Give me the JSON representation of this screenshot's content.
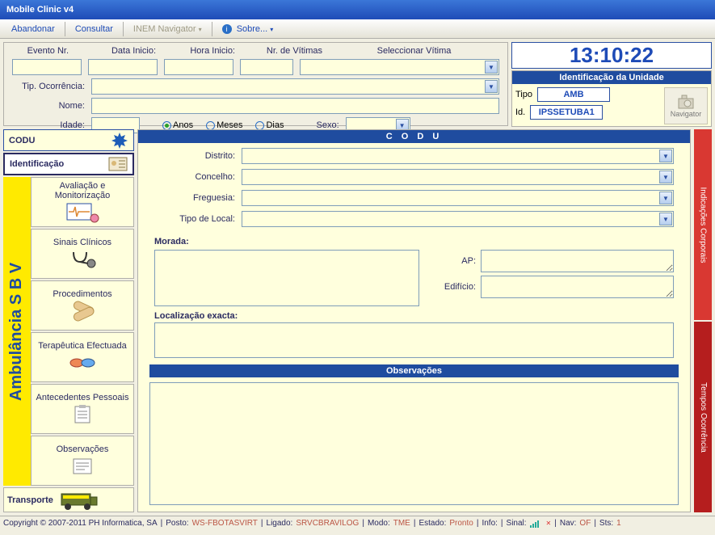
{
  "window_title": "Mobile Clinic v4",
  "menu": {
    "abandonar": "Abandonar",
    "consultar": "Consultar",
    "inem": "INEM Navigator",
    "sobre": "Sobre..."
  },
  "header": {
    "evento_nr": "Evento Nr.",
    "data_inicio": "Data Inicio:",
    "hora_inicio": "Hora Inicio:",
    "nr_vitimas": "Nr. de Vítimas",
    "sel_vitima": "Seleccionar Vítima",
    "tip_ocorrencia": "Tip. Ocorrência:",
    "nome": "Nome:",
    "idade": "Idade:",
    "anos": "Anos",
    "meses": "Meses",
    "dias": "Dias",
    "sexo": "Sexo:"
  },
  "clock": "13:10:22",
  "unit": {
    "title": "Identificação da Unidade",
    "tipo_label": "Tipo",
    "tipo_value": "AMB",
    "id_label": "Id.",
    "id_value": "IPSSETUBA1"
  },
  "navigator_btn": "Navigator",
  "sidebar": {
    "codu": "CODU",
    "identificacao": "Identificação",
    "avaliacao": "Avaliação e Monitorização",
    "sinais": "Sinais Clínicos",
    "procedimentos": "Procedimentos",
    "terapeutica": "Terapêutica Efectuada",
    "antecedentes": "Antecedentes Pessoais",
    "observacoes": "Observações",
    "transporte": "Transporte",
    "ambulance": "Ambulância S B V"
  },
  "form": {
    "section_title": "C O D U",
    "distrito": "Distrito:",
    "concelho": "Concelho:",
    "freguesia": "Freguesia:",
    "tipo_local": "Tipo de Local:",
    "morada": "Morada:",
    "ap": "AP:",
    "edificio": "Edifício:",
    "localizacao": "Localização  exacta:",
    "observacoes": "Observações"
  },
  "strips": {
    "indicacoes": "Indicações Corporais",
    "tempos": "Tempos Ocorrência"
  },
  "status": {
    "copyright": "Copyright © 2007-2011 PH Informatica, SA",
    "posto_label": "Posto:",
    "posto": "WS-FBOTASVIRT",
    "ligado_label": "Ligado:",
    "ligado": "SRVCBRAVILOG",
    "modo_label": "Modo:",
    "modo": "TME",
    "estado_label": "Estado:",
    "estado": "Pronto",
    "info_label": "Info:",
    "sinal_label": "Sinal:",
    "nav_label": "Nav:",
    "nav": "OF",
    "sts_label": "Sts:",
    "sts": "1"
  }
}
